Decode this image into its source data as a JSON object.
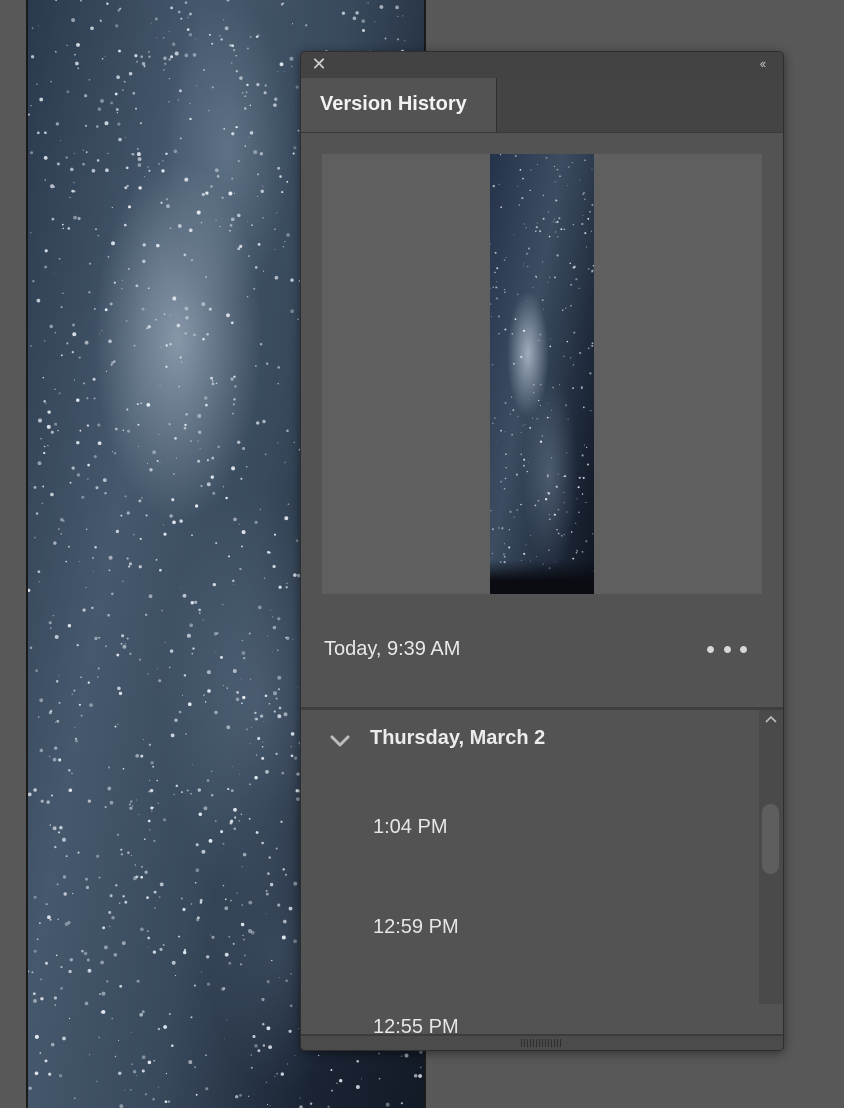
{
  "artboard": {
    "image": "milky-way-night-sky"
  },
  "panel": {
    "close_icon": "close-icon",
    "collapse_icon": "double-chevron-left-icon",
    "tab_label": "Version History",
    "current_version": {
      "timestamp": "Today, 9:39 AM",
      "more_icon": "more-options-icon"
    },
    "history": {
      "groups": [
        {
          "title": "Thursday, March 2",
          "expanded": true,
          "entries": [
            "1:04 PM",
            "12:59 PM",
            "12:55 PM"
          ]
        }
      ]
    }
  },
  "colors": {
    "panel_bg": "#535353",
    "tab_bar_bg": "#444444",
    "preview_bg": "#5f5f5f",
    "workspace_bg": "#585858",
    "text": "#e6e6e6"
  }
}
